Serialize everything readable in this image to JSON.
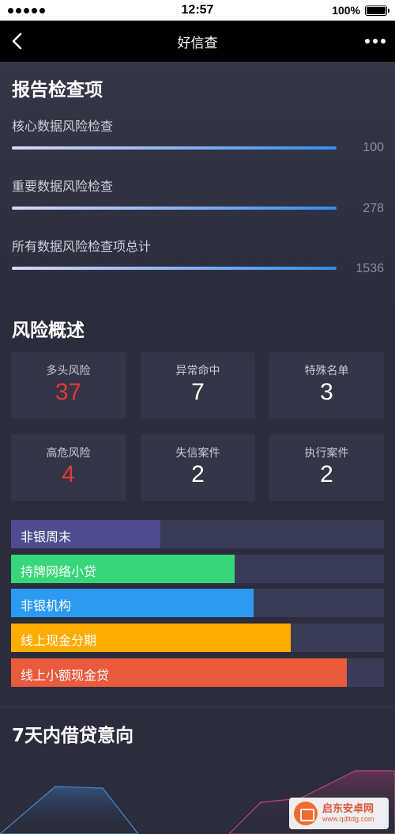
{
  "status_bar": {
    "time": "12:57",
    "battery": "100%"
  },
  "nav": {
    "title": "好信查",
    "back_icon": "chevron-left-icon",
    "more_icon": "more-dots-icon"
  },
  "report_section": {
    "title": "报告检查项",
    "items": [
      {
        "label": "核心数据风险检查",
        "value": "100"
      },
      {
        "label": "重要数据风险检查",
        "value": "278"
      },
      {
        "label": "所有数据风险检查项总计",
        "value": "1536"
      }
    ]
  },
  "risk_section": {
    "title": "风险概述",
    "tiles": [
      {
        "label": "多头风险",
        "value": "37",
        "color": "#e03a3a"
      },
      {
        "label": "异常命中",
        "value": "7",
        "color": "#ffffff"
      },
      {
        "label": "特殊名单",
        "value": "3",
        "color": "#ffffff"
      },
      {
        "label": "高危风险",
        "value": "4",
        "color": "#e03a3a"
      },
      {
        "label": "失信案件",
        "value": "2",
        "color": "#ffffff"
      },
      {
        "label": "执行案件",
        "value": "2",
        "color": "#ffffff"
      }
    ],
    "bars": [
      {
        "label": "非银周末",
        "fill": 0.4,
        "color": "#4e4c8e"
      },
      {
        "label": "持牌网络小贷",
        "fill": 0.6,
        "color": "#37d67a"
      },
      {
        "label": "非银机构",
        "fill": 0.65,
        "color": "#2b9af0"
      },
      {
        "label": "线上现金分期",
        "fill": 0.75,
        "color": "#ffac00"
      },
      {
        "label": "线上小额现金贷",
        "fill": 0.9,
        "color": "#ea5a3d"
      }
    ]
  },
  "intent_section": {
    "title": "7天内借贷意向"
  },
  "watermark": {
    "name": "启东安卓网",
    "url": "www.qdltdg.com"
  }
}
